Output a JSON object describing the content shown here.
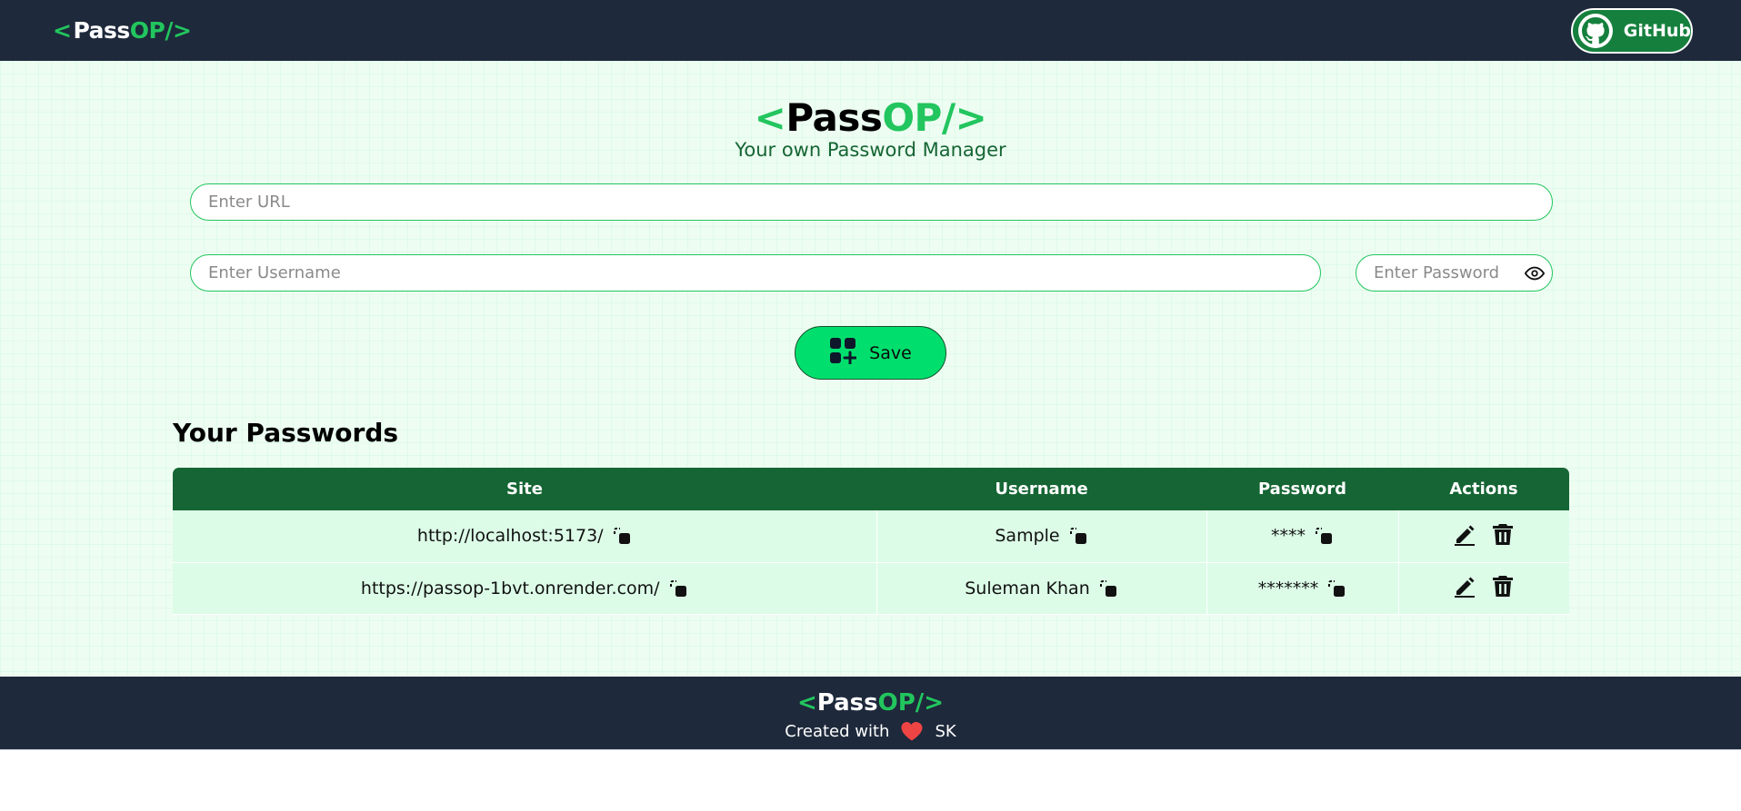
{
  "navbar": {
    "logo": {
      "open": "<",
      "pass": "Pass",
      "op": "OP/",
      "close": ">"
    },
    "github_label": "GitHub"
  },
  "hero": {
    "logo": {
      "open": "<",
      "pass": "Pass",
      "op": "OP/",
      "close": ">"
    },
    "subtitle": "Your own Password Manager"
  },
  "form": {
    "url_placeholder": "Enter URL",
    "username_placeholder": "Enter Username",
    "password_placeholder": "Enter Password",
    "save_label": "Save"
  },
  "passwords": {
    "title": "Your Passwords",
    "columns": [
      "Site",
      "Username",
      "Password",
      "Actions"
    ],
    "rows": [
      {
        "site": "http://localhost:5173/",
        "username": "Sample",
        "password": "****"
      },
      {
        "site": "https://passop-1bvt.onrender.com/",
        "username": "Suleman Khan",
        "password": "*******"
      }
    ]
  },
  "footer": {
    "logo": {
      "open": "<",
      "pass": "Pass",
      "op": "OP/",
      "close": ">"
    },
    "created_with": "Created with",
    "author": "SK"
  },
  "colors": {
    "nav_bg": "#1e293b",
    "brand_green": "#22c55e",
    "header_green": "#166534",
    "save_green": "#00df6d",
    "row_bg": "#dcfce7",
    "heart": "#ef4444"
  }
}
